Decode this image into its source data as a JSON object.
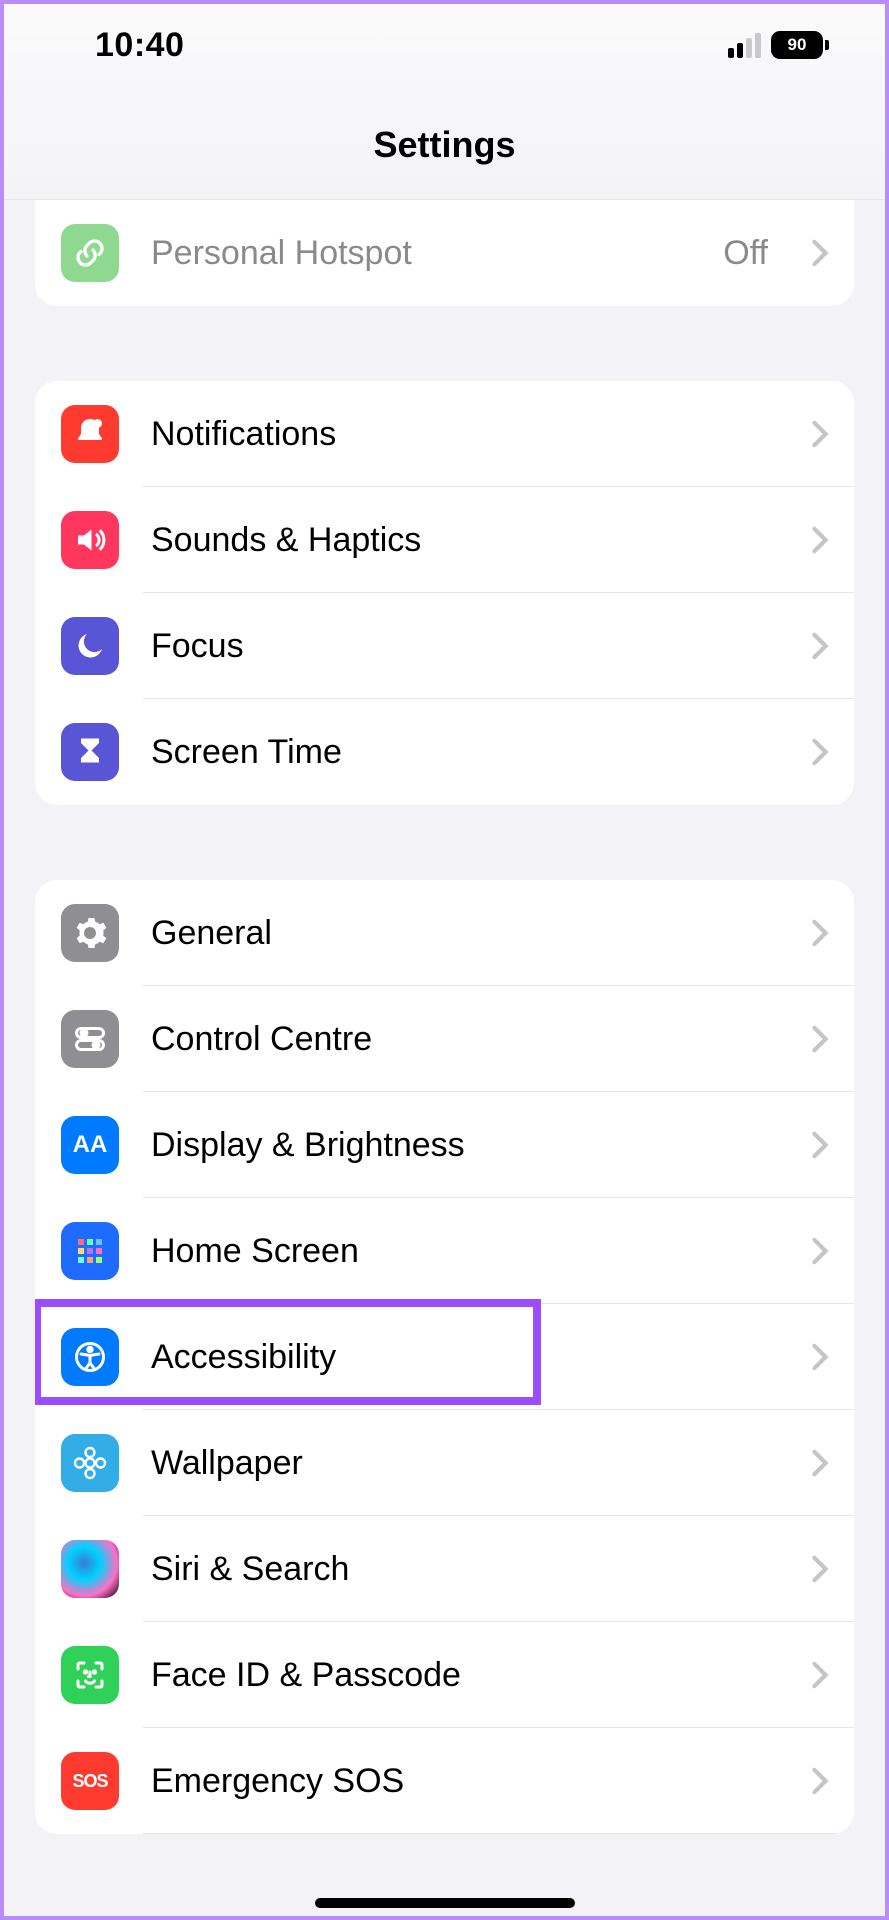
{
  "status": {
    "time": "10:40",
    "battery_pct": "90"
  },
  "header": {
    "title": "Settings"
  },
  "groups": [
    {
      "id": "connectivity_tail",
      "rows": [
        {
          "id": "personal-hotspot",
          "label": "Personal Hotspot",
          "value": "Off",
          "dim": true,
          "icon": "link-icon",
          "icon_bg": "bg-green-mint"
        }
      ]
    },
    {
      "id": "notifications_group",
      "rows": [
        {
          "id": "notifications",
          "label": "Notifications",
          "icon": "bell-icon",
          "icon_bg": "bg-red"
        },
        {
          "id": "sounds-haptics",
          "label": "Sounds & Haptics",
          "icon": "speaker-icon",
          "icon_bg": "bg-pink-red"
        },
        {
          "id": "focus",
          "label": "Focus",
          "icon": "moon-icon",
          "icon_bg": "bg-indigo"
        },
        {
          "id": "screen-time",
          "label": "Screen Time",
          "icon": "hourglass-icon",
          "icon_bg": "bg-indigo"
        }
      ]
    },
    {
      "id": "general_group",
      "rows": [
        {
          "id": "general",
          "label": "General",
          "icon": "gear-icon",
          "icon_bg": "bg-gray"
        },
        {
          "id": "control-centre",
          "label": "Control Centre",
          "icon": "toggles-icon",
          "icon_bg": "bg-gray"
        },
        {
          "id": "display-brightness",
          "label": "Display & Brightness",
          "icon": "aa-icon",
          "icon_bg": "bg-blue"
        },
        {
          "id": "home-screen",
          "label": "Home Screen",
          "icon": "grid-icon",
          "icon_bg": "bg-darkblue"
        },
        {
          "id": "accessibility",
          "label": "Accessibility",
          "icon": "accessibility-icon",
          "icon_bg": "bg-blue",
          "highlighted": true
        },
        {
          "id": "wallpaper",
          "label": "Wallpaper",
          "icon": "flower-icon",
          "icon_bg": "bg-teal"
        },
        {
          "id": "siri-search",
          "label": "Siri & Search",
          "icon": "siri-icon",
          "icon_bg": "bg-siri"
        },
        {
          "id": "face-id-passcode",
          "label": "Face ID & Passcode",
          "icon": "faceid-icon",
          "icon_bg": "bg-green"
        },
        {
          "id": "emergency-sos",
          "label": "Emergency SOS",
          "icon": "sos-icon",
          "icon_bg": "bg-red"
        }
      ]
    }
  ]
}
